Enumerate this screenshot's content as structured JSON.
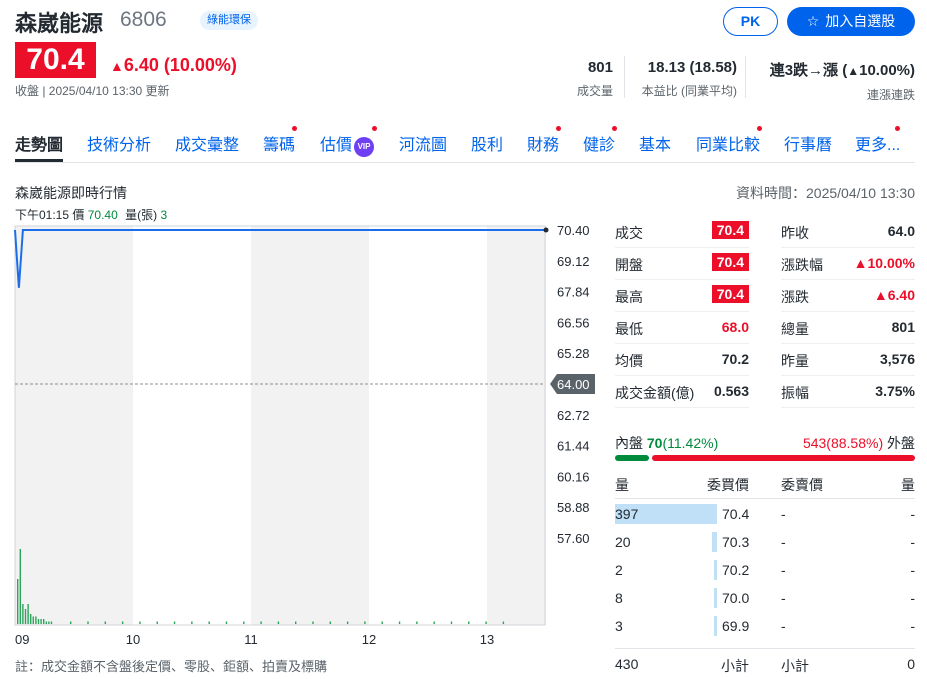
{
  "stock": {
    "name": "森崴能源",
    "code": "6806",
    "tag": "綠能環保",
    "price": "70.4",
    "change": "6.40 (10.00%)",
    "closed_text": "收盤 | 2025/04/10 13:30 更新"
  },
  "buttons": {
    "pk": "PK",
    "add": "加入自選股"
  },
  "stats": [
    {
      "value": "801",
      "label": "成交量"
    },
    {
      "value": "18.13 (18.58)",
      "label": "本益比 (同業平均)"
    },
    {
      "value": "連3跌→漲 (",
      "value_tail": "10.00%)",
      "label": "連漲連跌"
    }
  ],
  "tabs": [
    "走勢圖",
    "技術分析",
    "成交彙整",
    "籌碼",
    "估價",
    "河流圖",
    "股利",
    "財務",
    "健診",
    "基本",
    "同業比較",
    "行事曆",
    "更多..."
  ],
  "vip_label": "VIP",
  "chart": {
    "title": "森崴能源即時行情",
    "data_time": "資料時間：2025/04/10 13:30",
    "tooltip": {
      "time": "下午01:15",
      "price_label": "價",
      "price": "70.40",
      "vol_label": "量(張)",
      "vol": "3"
    },
    "note": "註：成交金額不含盤後定價、零股、鉅額、拍賣及標購"
  },
  "chart_data": {
    "type": "line",
    "x_ticks": [
      "09",
      "10",
      "11",
      "12",
      "13"
    ],
    "y_ticks": [
      "70.40",
      "69.12",
      "67.84",
      "66.56",
      "65.28",
      "64.00",
      "62.72",
      "61.44",
      "60.16",
      "58.88",
      "57.60"
    ],
    "ylim": [
      57.6,
      70.4
    ],
    "ref_price": 64.0,
    "price_series": [
      {
        "time": "09:00",
        "value": 70.4
      },
      {
        "time": "09:02",
        "value": 68.0
      },
      {
        "time": "09:04",
        "value": 70.4
      },
      {
        "time": "13:30",
        "value": 70.4
      }
    ],
    "volume_series": [
      18,
      30,
      8,
      6,
      8,
      4,
      3,
      3,
      2,
      2,
      2,
      1,
      1,
      1,
      1,
      1,
      1,
      1,
      1,
      1,
      1,
      1,
      1,
      1,
      1,
      1,
      1,
      1,
      1,
      1,
      1,
      1,
      1,
      1,
      1,
      1,
      1,
      1,
      1,
      1
    ]
  },
  "quote": {
    "left": [
      {
        "label": "成交",
        "value": "70.4",
        "style": "box"
      },
      {
        "label": "開盤",
        "value": "70.4",
        "style": "box"
      },
      {
        "label": "最高",
        "value": "70.4",
        "style": "box"
      },
      {
        "label": "最低",
        "value": "68.0",
        "style": "red"
      },
      {
        "label": "均價",
        "value": "70.2",
        "style": ""
      },
      {
        "label": "成交金額(億)",
        "value": "0.563",
        "style": ""
      }
    ],
    "right": [
      {
        "label": "昨收",
        "value": "64.0",
        "style": ""
      },
      {
        "label": "漲跌幅",
        "value": "▲10.00%",
        "style": "red"
      },
      {
        "label": "漲跌",
        "value": "▲6.40",
        "style": "red"
      },
      {
        "label": "總量",
        "value": "801",
        "style": ""
      },
      {
        "label": "昨量",
        "value": "3,576",
        "style": ""
      },
      {
        "label": "振幅",
        "value": "3.75%",
        "style": ""
      }
    ]
  },
  "buysell": {
    "inner_label": "內盤",
    "inner_value": "70",
    "inner_pct": "(11.42%)",
    "outer_value": "543",
    "outer_pct": "(88.58%)",
    "outer_label": "外盤",
    "inner_ratio": 0.1142
  },
  "orderbook": {
    "headers": {
      "qty": "量",
      "bid": "委買價",
      "ask": "委賣價",
      "qty2": "量"
    },
    "bids": [
      {
        "qty": "397",
        "price": "70.4",
        "ratio": 1.0
      },
      {
        "qty": "20",
        "price": "70.3",
        "ratio": 0.05
      },
      {
        "qty": "2",
        "price": "70.2",
        "ratio": 0.005
      },
      {
        "qty": "8",
        "price": "70.0",
        "ratio": 0.02
      },
      {
        "qty": "3",
        "price": "69.9",
        "ratio": 0.008
      }
    ],
    "asks": [
      {
        "price": "-",
        "qty": "-"
      },
      {
        "price": "-",
        "qty": "-"
      },
      {
        "price": "-",
        "qty": "-"
      },
      {
        "price": "-",
        "qty": "-"
      },
      {
        "price": "-",
        "qty": "-"
      }
    ],
    "bid_total": "430",
    "subtotal_label": "小計",
    "ask_total": "0"
  },
  "colors": {
    "up": "#eb0f29",
    "down": "#008a3c",
    "brand": "#0063eb",
    "line": "#1c6ee8"
  }
}
